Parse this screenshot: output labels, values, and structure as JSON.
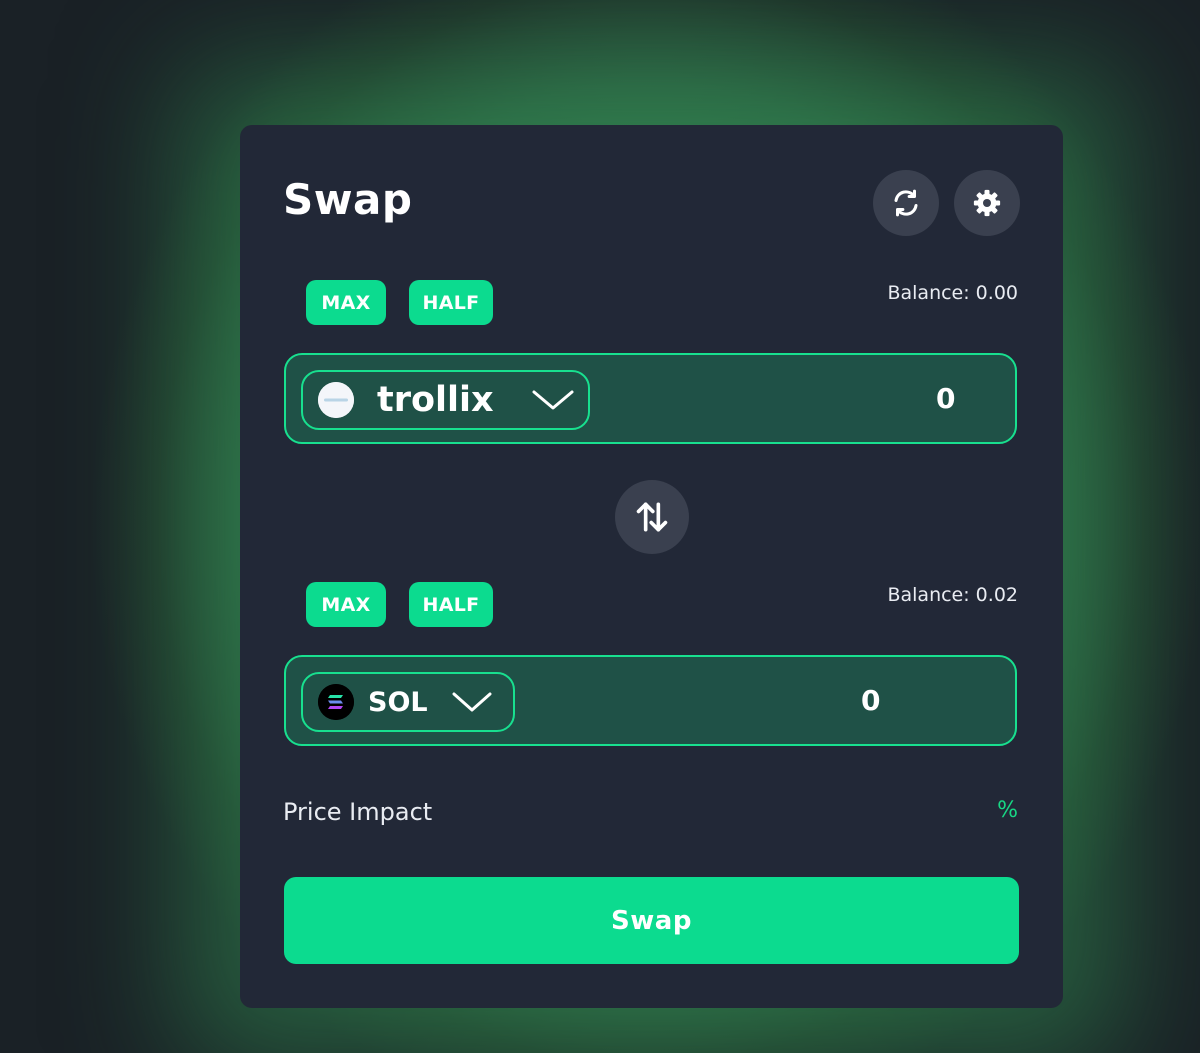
{
  "swap": {
    "title": "Swap",
    "header_icons": [
      "refresh-icon",
      "gear-icon"
    ],
    "from": {
      "max_label": "MAX",
      "half_label": "HALF",
      "balance": "Balance: 0.00",
      "token": "trollix",
      "token_icon": "trollix-token-icon",
      "amount": "0"
    },
    "flip_icon": "swap-arrows-icon",
    "to": {
      "max_label": "MAX",
      "half_label": "HALF",
      "balance": "Balance: 0.02",
      "token": "SOL",
      "token_icon": "sol-token-icon",
      "amount": "0"
    },
    "price_impact_label": "Price Impact",
    "price_impact_value": "%",
    "submit_label": "Swap"
  },
  "colors": {
    "accent": "#0cdb8f",
    "card": "#222837",
    "field_bg": "#1f5147",
    "field_border": "#18e08f",
    "icon_button": "#3a404f"
  }
}
